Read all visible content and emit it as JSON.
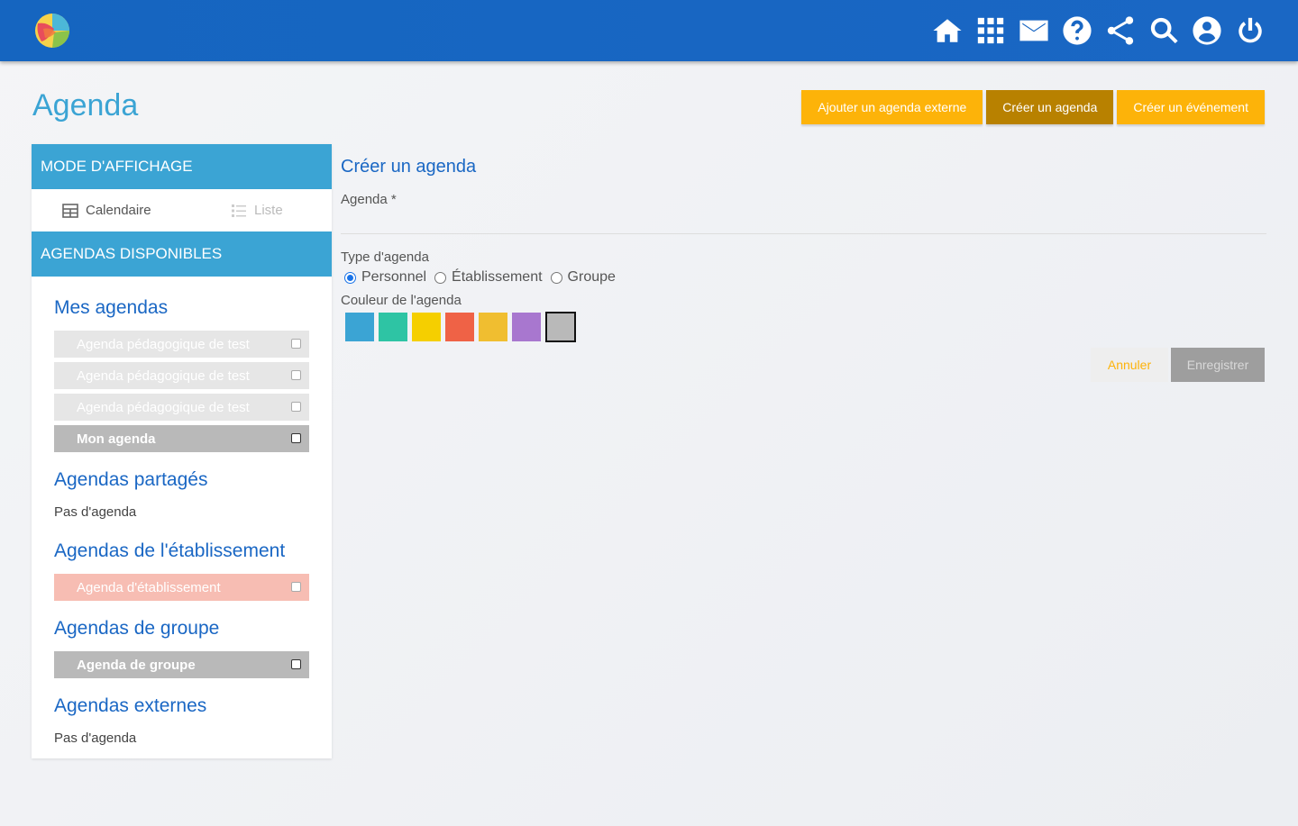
{
  "header": {
    "logo_icon": "app-logo",
    "icons": [
      "home-icon",
      "apps-grid-icon",
      "mail-icon",
      "help-icon",
      "share-icon",
      "search-icon",
      "account-icon",
      "power-icon"
    ]
  },
  "page": {
    "title": "Agenda"
  },
  "actions": {
    "add_external": "Ajouter un agenda externe",
    "create_agenda": "Créer un agenda",
    "create_event": "Créer un événement"
  },
  "sidebar": {
    "mode_header": "MODE D'AFFICHAGE",
    "view_calendar": "Calendaire",
    "view_list": "Liste",
    "available_header": "AGENDAS DISPONIBLES",
    "my_agendas": {
      "title": "Mes agendas",
      "items": [
        {
          "label": "Agenda pédagogique de test"
        },
        {
          "label": "Agenda pédagogique de test"
        },
        {
          "label": "Agenda pédagogique de test"
        },
        {
          "label": "Mon agenda"
        }
      ]
    },
    "shared": {
      "title": "Agendas partagés",
      "empty": "Pas d'agenda"
    },
    "establishment": {
      "title": "Agendas de l'établissement",
      "items": [
        {
          "label": "Agenda d'établissement"
        }
      ]
    },
    "group": {
      "title": "Agendas de groupe",
      "items": [
        {
          "label": "Agenda de groupe"
        }
      ]
    },
    "external": {
      "title": "Agendas externes",
      "empty": "Pas d'agenda"
    }
  },
  "form": {
    "title": "Créer un agenda",
    "agenda_label": "Agenda *",
    "agenda_value": "",
    "type_label": "Type d'agenda",
    "type_options": [
      "Personnel",
      "Établissement",
      "Groupe"
    ],
    "type_selected": "Personnel",
    "color_label": "Couleur de l'agenda",
    "colors": [
      "#3ba4d4",
      "#2ec4a4",
      "#f5cf00",
      "#ef6246",
      "#f0be30",
      "#a877cf",
      "#b9b9b9"
    ],
    "color_selected": "#b9b9b9",
    "cancel": "Annuler",
    "save": "Enregistrer"
  }
}
